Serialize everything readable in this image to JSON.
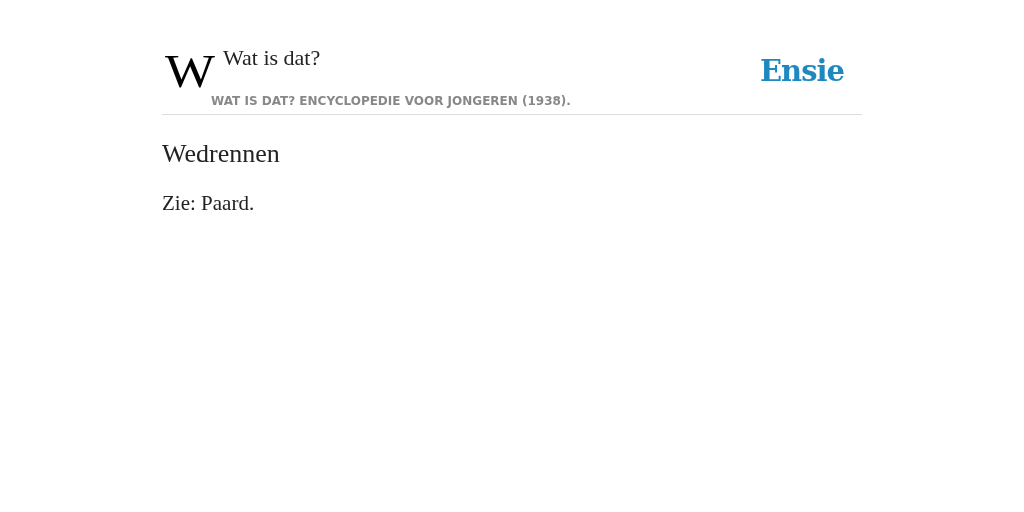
{
  "header": {
    "logo": "W",
    "title": "Wat is dat?",
    "subtitle": "WAT IS DAT? ENCYCLOPEDIE VOOR JONGEREN (1938).",
    "brand": "Ensie"
  },
  "article": {
    "title": "Wedrennen",
    "body": "Zie: Paard."
  }
}
